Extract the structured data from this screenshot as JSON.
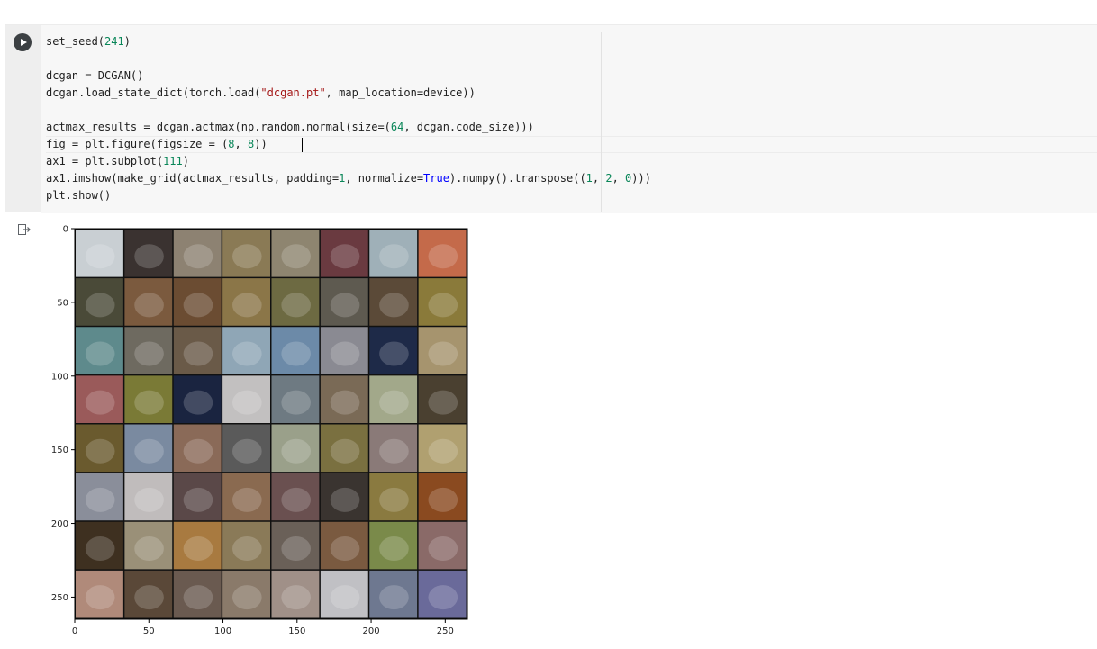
{
  "cell": {
    "run_button": "run-cell",
    "code_lines": [
      [
        {
          "t": "set_seed("
        },
        {
          "t": "241",
          "c": "num"
        },
        {
          "t": ")"
        }
      ],
      [],
      [
        {
          "t": "dcgan = DCGAN()"
        }
      ],
      [
        {
          "t": "dcgan.load_state_dict(torch.load("
        },
        {
          "t": "\"dcgan.pt\"",
          "c": "str"
        },
        {
          "t": ", map_location=device))"
        }
      ],
      [],
      [
        {
          "t": "actmax_results = dcgan.actmax(np.random.normal(size=("
        },
        {
          "t": "64",
          "c": "num"
        },
        {
          "t": ", dcgan.code_size)))"
        }
      ],
      [
        {
          "t": "fig = plt.figure(figsize = ("
        },
        {
          "t": "8",
          "c": "num"
        },
        {
          "t": ", "
        },
        {
          "t": "8",
          "c": "num"
        },
        {
          "t": "))"
        }
      ],
      [
        {
          "t": "ax1 = plt.subplot("
        },
        {
          "t": "111",
          "c": "num"
        },
        {
          "t": ")"
        }
      ],
      [
        {
          "t": "ax1.imshow(make_grid(actmax_results, padding="
        },
        {
          "t": "1",
          "c": "num"
        },
        {
          "t": ", normalize="
        },
        {
          "t": "True",
          "c": "kw"
        },
        {
          "t": ").numpy().transpose(("
        },
        {
          "t": "1",
          "c": "num"
        },
        {
          "t": ", "
        },
        {
          "t": "2",
          "c": "num"
        },
        {
          "t": ", "
        },
        {
          "t": "0",
          "c": "num"
        },
        {
          "t": ")))"
        }
      ],
      [
        {
          "t": "plt.show()"
        }
      ]
    ]
  },
  "output": {
    "icon": "output-redirect-icon",
    "figure": {
      "grid": {
        "rows": 8,
        "cols": 8
      },
      "x_ticks": [
        "0",
        "50",
        "100",
        "150",
        "200",
        "250"
      ],
      "y_ticks": [
        "0",
        "50",
        "100",
        "150",
        "200",
        "250"
      ],
      "x_tick_values": [
        0,
        50,
        100,
        150,
        200,
        250
      ],
      "y_tick_values": [
        0,
        50,
        100,
        150,
        200,
        250
      ],
      "extent": [
        0,
        265
      ],
      "tile_colors": [
        [
          "#c9cfd3",
          "#3a3230",
          "#8d8272",
          "#8a7a55",
          "#8e8570",
          "#6a3a40",
          "#9fb0b8",
          "#c46a4a"
        ],
        [
          "#4a4a38",
          "#7b5a3e",
          "#6b4c32",
          "#8b7648",
          "#6d6a42",
          "#5e5a50",
          "#5b4a38",
          "#8a7a3a"
        ],
        [
          "#5e8a8c",
          "#6e6a60",
          "#6a5a48",
          "#8fa6b6",
          "#6c8aa8",
          "#8a8a92",
          "#1e2a48",
          "#a6946e"
        ],
        [
          "#9a5a5a",
          "#7a7a36",
          "#1a2440",
          "#c2c0c0",
          "#6e7a82",
          "#7a6a56",
          "#a2a88a",
          "#4a4030"
        ],
        [
          "#6a5a2e",
          "#7a8aa0",
          "#8a6a58",
          "#5a5a5a",
          "#9aa08a",
          "#7a7040",
          "#8a7a78",
          "#b0a070"
        ],
        [
          "#8a8e9a",
          "#c0bcbc",
          "#5a4848",
          "#8a6a50",
          "#6a5050",
          "#3a3430",
          "#8a7a40",
          "#8a4a20"
        ],
        [
          "#3e3020",
          "#9a9078",
          "#a87a40",
          "#8a7a58",
          "#6a6058",
          "#7a5a40",
          "#7a8a4a",
          "#8a6a68"
        ],
        [
          "#b08a7a",
          "#5a4838",
          "#6a5a50",
          "#8a7a6a",
          "#a09088",
          "#c0c0c4",
          "#6e7890",
          "#6a6a9a"
        ]
      ]
    }
  }
}
